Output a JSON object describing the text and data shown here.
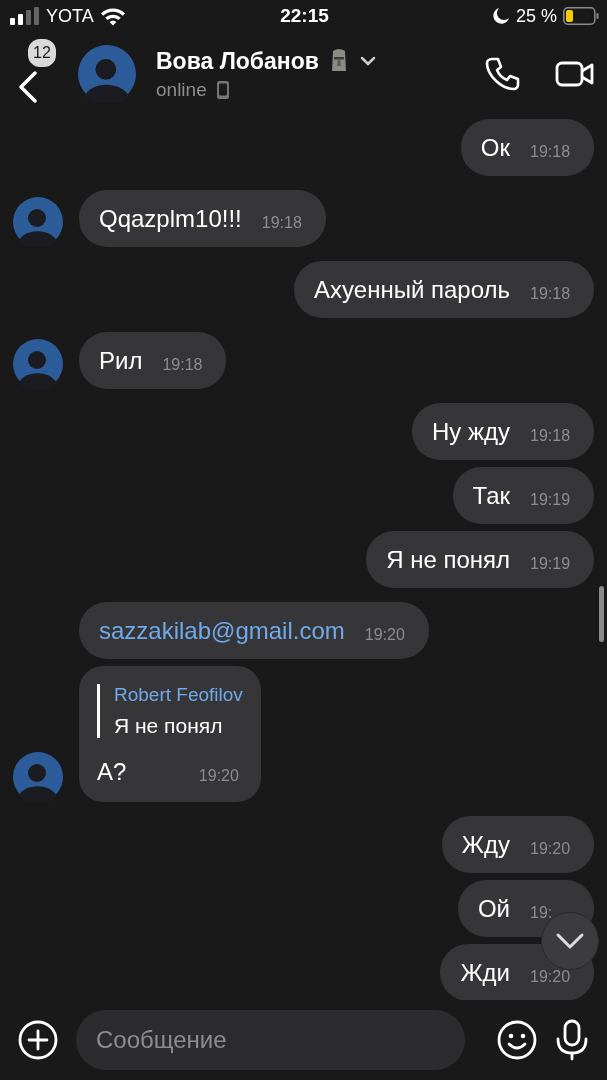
{
  "status_bar": {
    "carrier": "YOTA",
    "time": "22:15",
    "battery": "25 %"
  },
  "header": {
    "back_badge": "12",
    "name": "Вова Лобанов",
    "presence": "online"
  },
  "messages": [
    {
      "kind": "text",
      "outgoing": true,
      "text": "Ок",
      "time": "19:18"
    },
    {
      "kind": "text",
      "outgoing": false,
      "avatar": true,
      "text": "Qqazplm10!!!",
      "time": "19:18"
    },
    {
      "kind": "text",
      "outgoing": true,
      "text": "Ахуенный пароль",
      "time": "19:18"
    },
    {
      "kind": "text",
      "outgoing": false,
      "avatar": true,
      "text": "Рил",
      "time": "19:18"
    },
    {
      "kind": "text",
      "outgoing": true,
      "text": "Ну жду",
      "time": "19:18"
    },
    {
      "kind": "text",
      "outgoing": true,
      "text": "Так",
      "time": "19:19"
    },
    {
      "kind": "text",
      "outgoing": true,
      "text": "Я не понял",
      "time": "19:19"
    },
    {
      "kind": "link",
      "outgoing": false,
      "avatar": false,
      "text": "sazzakilab@gmail.com",
      "time": "19:20"
    },
    {
      "kind": "reply",
      "outgoing": false,
      "avatar": true,
      "reply_author": "Robert Feofilov",
      "reply_text": "Я не понял",
      "text": "А?",
      "time": "19:20"
    },
    {
      "kind": "text",
      "outgoing": true,
      "text": "Жду",
      "time": "19:20"
    },
    {
      "kind": "text",
      "outgoing": true,
      "text": "Ой",
      "time": "19:"
    },
    {
      "kind": "text",
      "outgoing": true,
      "text": "Жди",
      "time": "19:20"
    }
  ],
  "composer": {
    "placeholder": "Сообщение"
  }
}
